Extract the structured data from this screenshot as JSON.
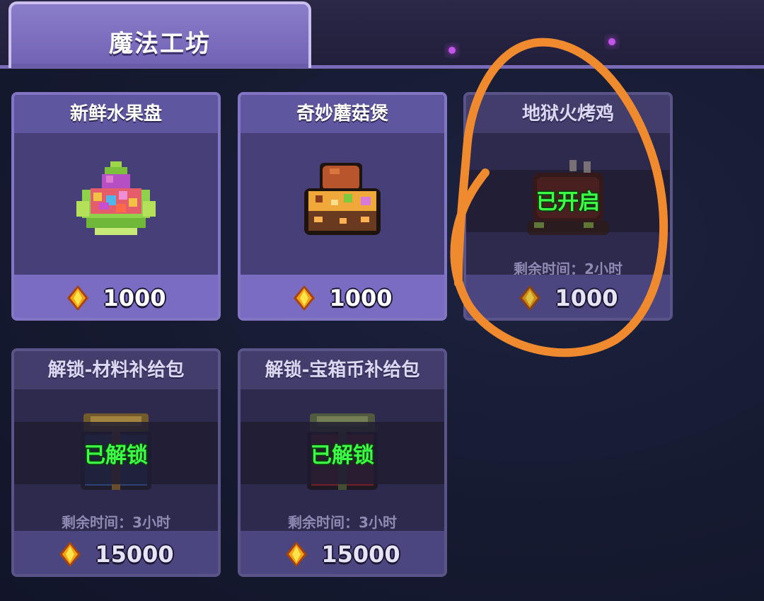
{
  "tab": {
    "label": "魔法工坊"
  },
  "colors": {
    "status_green": "#3dff46",
    "annotation": "#f08a2e",
    "tab_purple": "#7a6bc3"
  },
  "cards": [
    {
      "title": "新鲜水果盘",
      "price": "1000",
      "icon": "fruit-plate-icon"
    },
    {
      "title": "奇妙蘑菇煲",
      "price": "1000",
      "icon": "mushroom-pot-icon"
    },
    {
      "title": "地狱火烤鸡",
      "price": "1000",
      "status": "已开启",
      "remaining": "剩余时间：2小时",
      "icon": "roast-chicken-icon"
    },
    {
      "title": "解锁-材料补给包",
      "price": "15000",
      "status": "已解锁",
      "remaining": "剩余时间：3小时",
      "icon": "material-pack-icon"
    },
    {
      "title": "解锁-宝箱币补给包",
      "price": "15000",
      "status": "已解锁",
      "remaining": "剩余时间：3小时",
      "icon": "chest-coin-pack-icon"
    }
  ],
  "currency_icon": "gold-gem-icon"
}
